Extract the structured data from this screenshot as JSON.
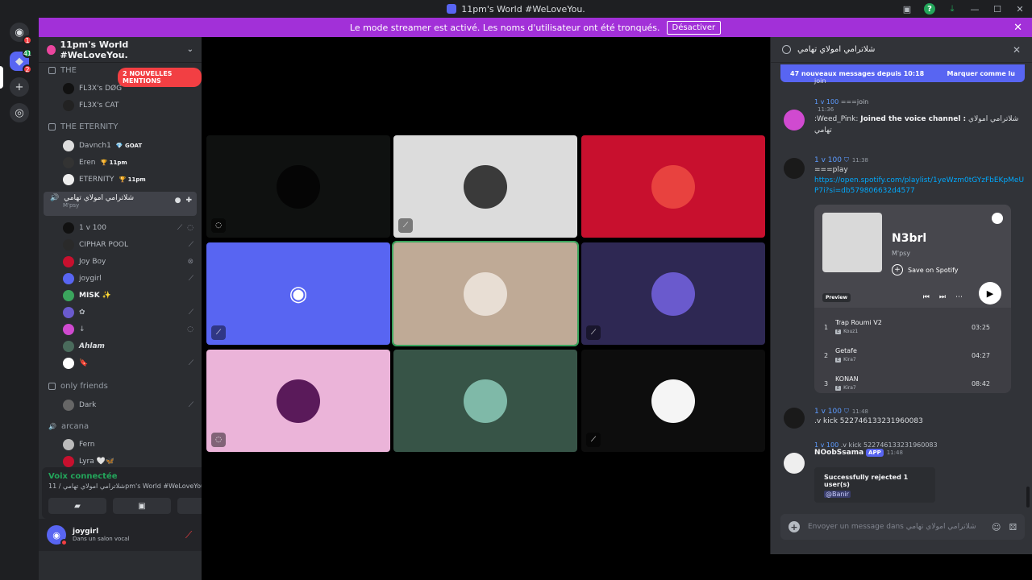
{
  "titlebar": {
    "title": "11pm's World #WeLoveYou."
  },
  "banner": {
    "text": "Le mode streamer est activé. Les noms d'utilisateur ont été tronqués.",
    "button": "Désactiver"
  },
  "rail": {
    "badge_home": "1",
    "badge_server_top": "41",
    "badge_server_bottom": "2"
  },
  "sidebar": {
    "server_name": "11pm's World #WeLoveYou.",
    "mentions": "2 NOUVELLES MENTIONS",
    "category1": "THE",
    "cat1_users": [
      {
        "name": "FL3X's DØG"
      },
      {
        "name": "FL3X's CAT"
      }
    ],
    "category2": "THE ETERNITY",
    "cat2_users": [
      {
        "name": "Davnch1",
        "tag": "💎 GOAT"
      },
      {
        "name": "Eren",
        "tag": "🏆 11pm"
      },
      {
        "name": "ETERNITY",
        "tag": "🏆 11pm"
      }
    ],
    "voice_channel": {
      "name": "شلاترامي امولاي تهامي",
      "status": "M'psy"
    },
    "voice_users": [
      {
        "name": "1 v 100"
      },
      {
        "name": "CIPHAR POOL"
      },
      {
        "name": "Joy Boy"
      },
      {
        "name": "joygirl"
      },
      {
        "name": "MISK ✨"
      },
      {
        "name": "✿"
      },
      {
        "name": "↓"
      },
      {
        "name": "Ahlam"
      },
      {
        "name": "🔖"
      }
    ],
    "category3": "only friends",
    "cat3_users": [
      {
        "name": "Dark"
      }
    ],
    "category4": "arcana",
    "cat4_users": [
      {
        "name": "Fern"
      },
      {
        "name": "Lyra 🤍🦋"
      }
    ]
  },
  "voice_panel": {
    "status": "Voix connectée",
    "channel": "شلاترامي امولاي تهامي / 11pm's World #WeLoveYou."
  },
  "self": {
    "name": "joygirl",
    "status": "Dans un salon vocal"
  },
  "chat": {
    "title": "شلاترامي امولاي تهامي",
    "new_messages": "47 nouveaux messages depuis 10:18",
    "mark_read": "Marquer comme lu",
    "partial_top": "join",
    "msg1_reply_user": "1 v 100",
    "msg1_reply_text": "===join",
    "msg1_time": "11:36",
    "msg1_text_prefix": ":Weed_Pink:",
    "msg1_text_bold": "Joined the voice channel :",
    "msg1_text_suffix": "شلاترامي امولاي تهامي",
    "msg2_user": "1 v 100",
    "msg2_time": "11:38",
    "msg2_text": "===play",
    "msg2_link": "https://open.spotify.com/playlist/1yeWzm0tGYzFbEKpMeUP7i?si=db579806632d4577",
    "spotify": {
      "title": "N3brl",
      "artist": "M'psy",
      "save": "Save on Spotify",
      "preview": "Preview",
      "tracks": [
        {
          "num": "1",
          "name": "Trap Roumi V2",
          "artist": "Kouz1",
          "dur": "03:25"
        },
        {
          "num": "2",
          "name": "Getafe",
          "artist": "Kira7",
          "dur": "04:27"
        },
        {
          "num": "3",
          "name": "KONAN",
          "artist": "Kira7",
          "dur": "08:42"
        }
      ]
    },
    "msg3_user": "1 v 100",
    "msg3_time": "11:48",
    "msg3_text": ".v kick 522746133231960083",
    "msg4_reply_user": "1 v 100",
    "msg4_reply_text": ".v kick 522746133231960083",
    "msg4_user": "NOobSsama",
    "msg4_app": "APP",
    "msg4_time": "11:48",
    "embed_title": "Successfully rejected 1 user(s)",
    "embed_mention": "@Banir",
    "input_placeholder": "Envoyer un message dans شلاترامي امولاي تهامي"
  },
  "colors": {
    "accent": "#5865f2",
    "banner": "#a230d8",
    "connected": "#23a55a",
    "danger": "#f23f43"
  }
}
